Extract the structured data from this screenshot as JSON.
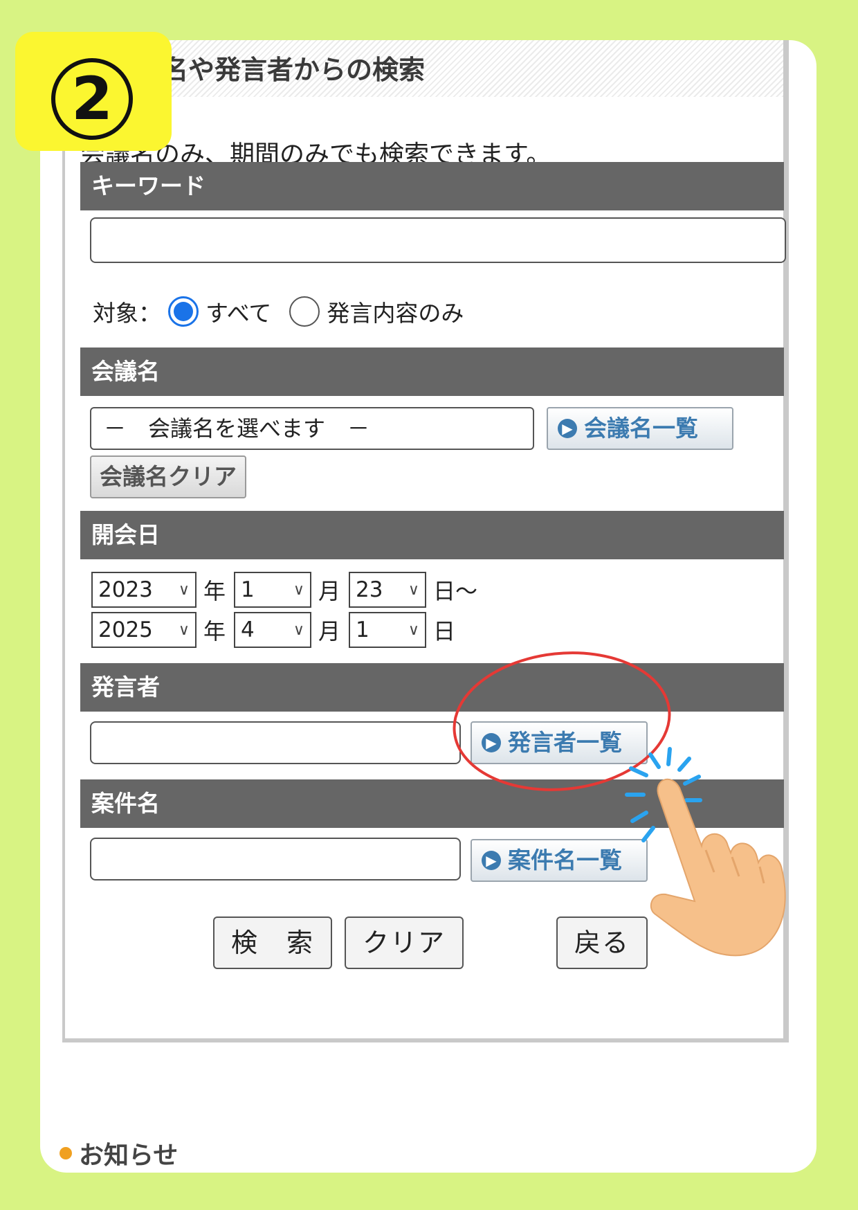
{
  "step": {
    "number": "2"
  },
  "panel": {
    "title": "名や発言者からの検索",
    "hint": "会議名のみ、期間のみでも検索できます。"
  },
  "keyword": {
    "header": "キーワード",
    "value": "",
    "target_label": "対象：",
    "options": [
      "すべて",
      "発言内容のみ"
    ],
    "selected": "すべて"
  },
  "meeting": {
    "header": "会議名",
    "select_value": "－　会議名を選べます　－",
    "list_button": "会議名一覧",
    "clear_button": "会議名クリア"
  },
  "date": {
    "header": "開会日",
    "from": {
      "year": "2023",
      "month": "1",
      "day": "23"
    },
    "to": {
      "year": "2025",
      "month": "4",
      "day": "1"
    },
    "year_unit": "年",
    "month_unit": "月",
    "day_unit_from": "日～",
    "day_unit_to": "日"
  },
  "speaker": {
    "header": "発言者",
    "value": "",
    "list_button": "発言者一覧"
  },
  "case": {
    "header": "案件名",
    "value": "",
    "list_button": "案件名一覧"
  },
  "actions": {
    "search": "検　索",
    "clear": "クリア",
    "back": "戻る"
  },
  "notice": {
    "label": "お知らせ"
  },
  "colors": {
    "background": "#d8f383",
    "section_header": "#666666",
    "highlight_circle": "#e53935",
    "tap_sparkle": "#2aa3ef",
    "hand": "#f6c08a",
    "badge": "#fbf630"
  }
}
